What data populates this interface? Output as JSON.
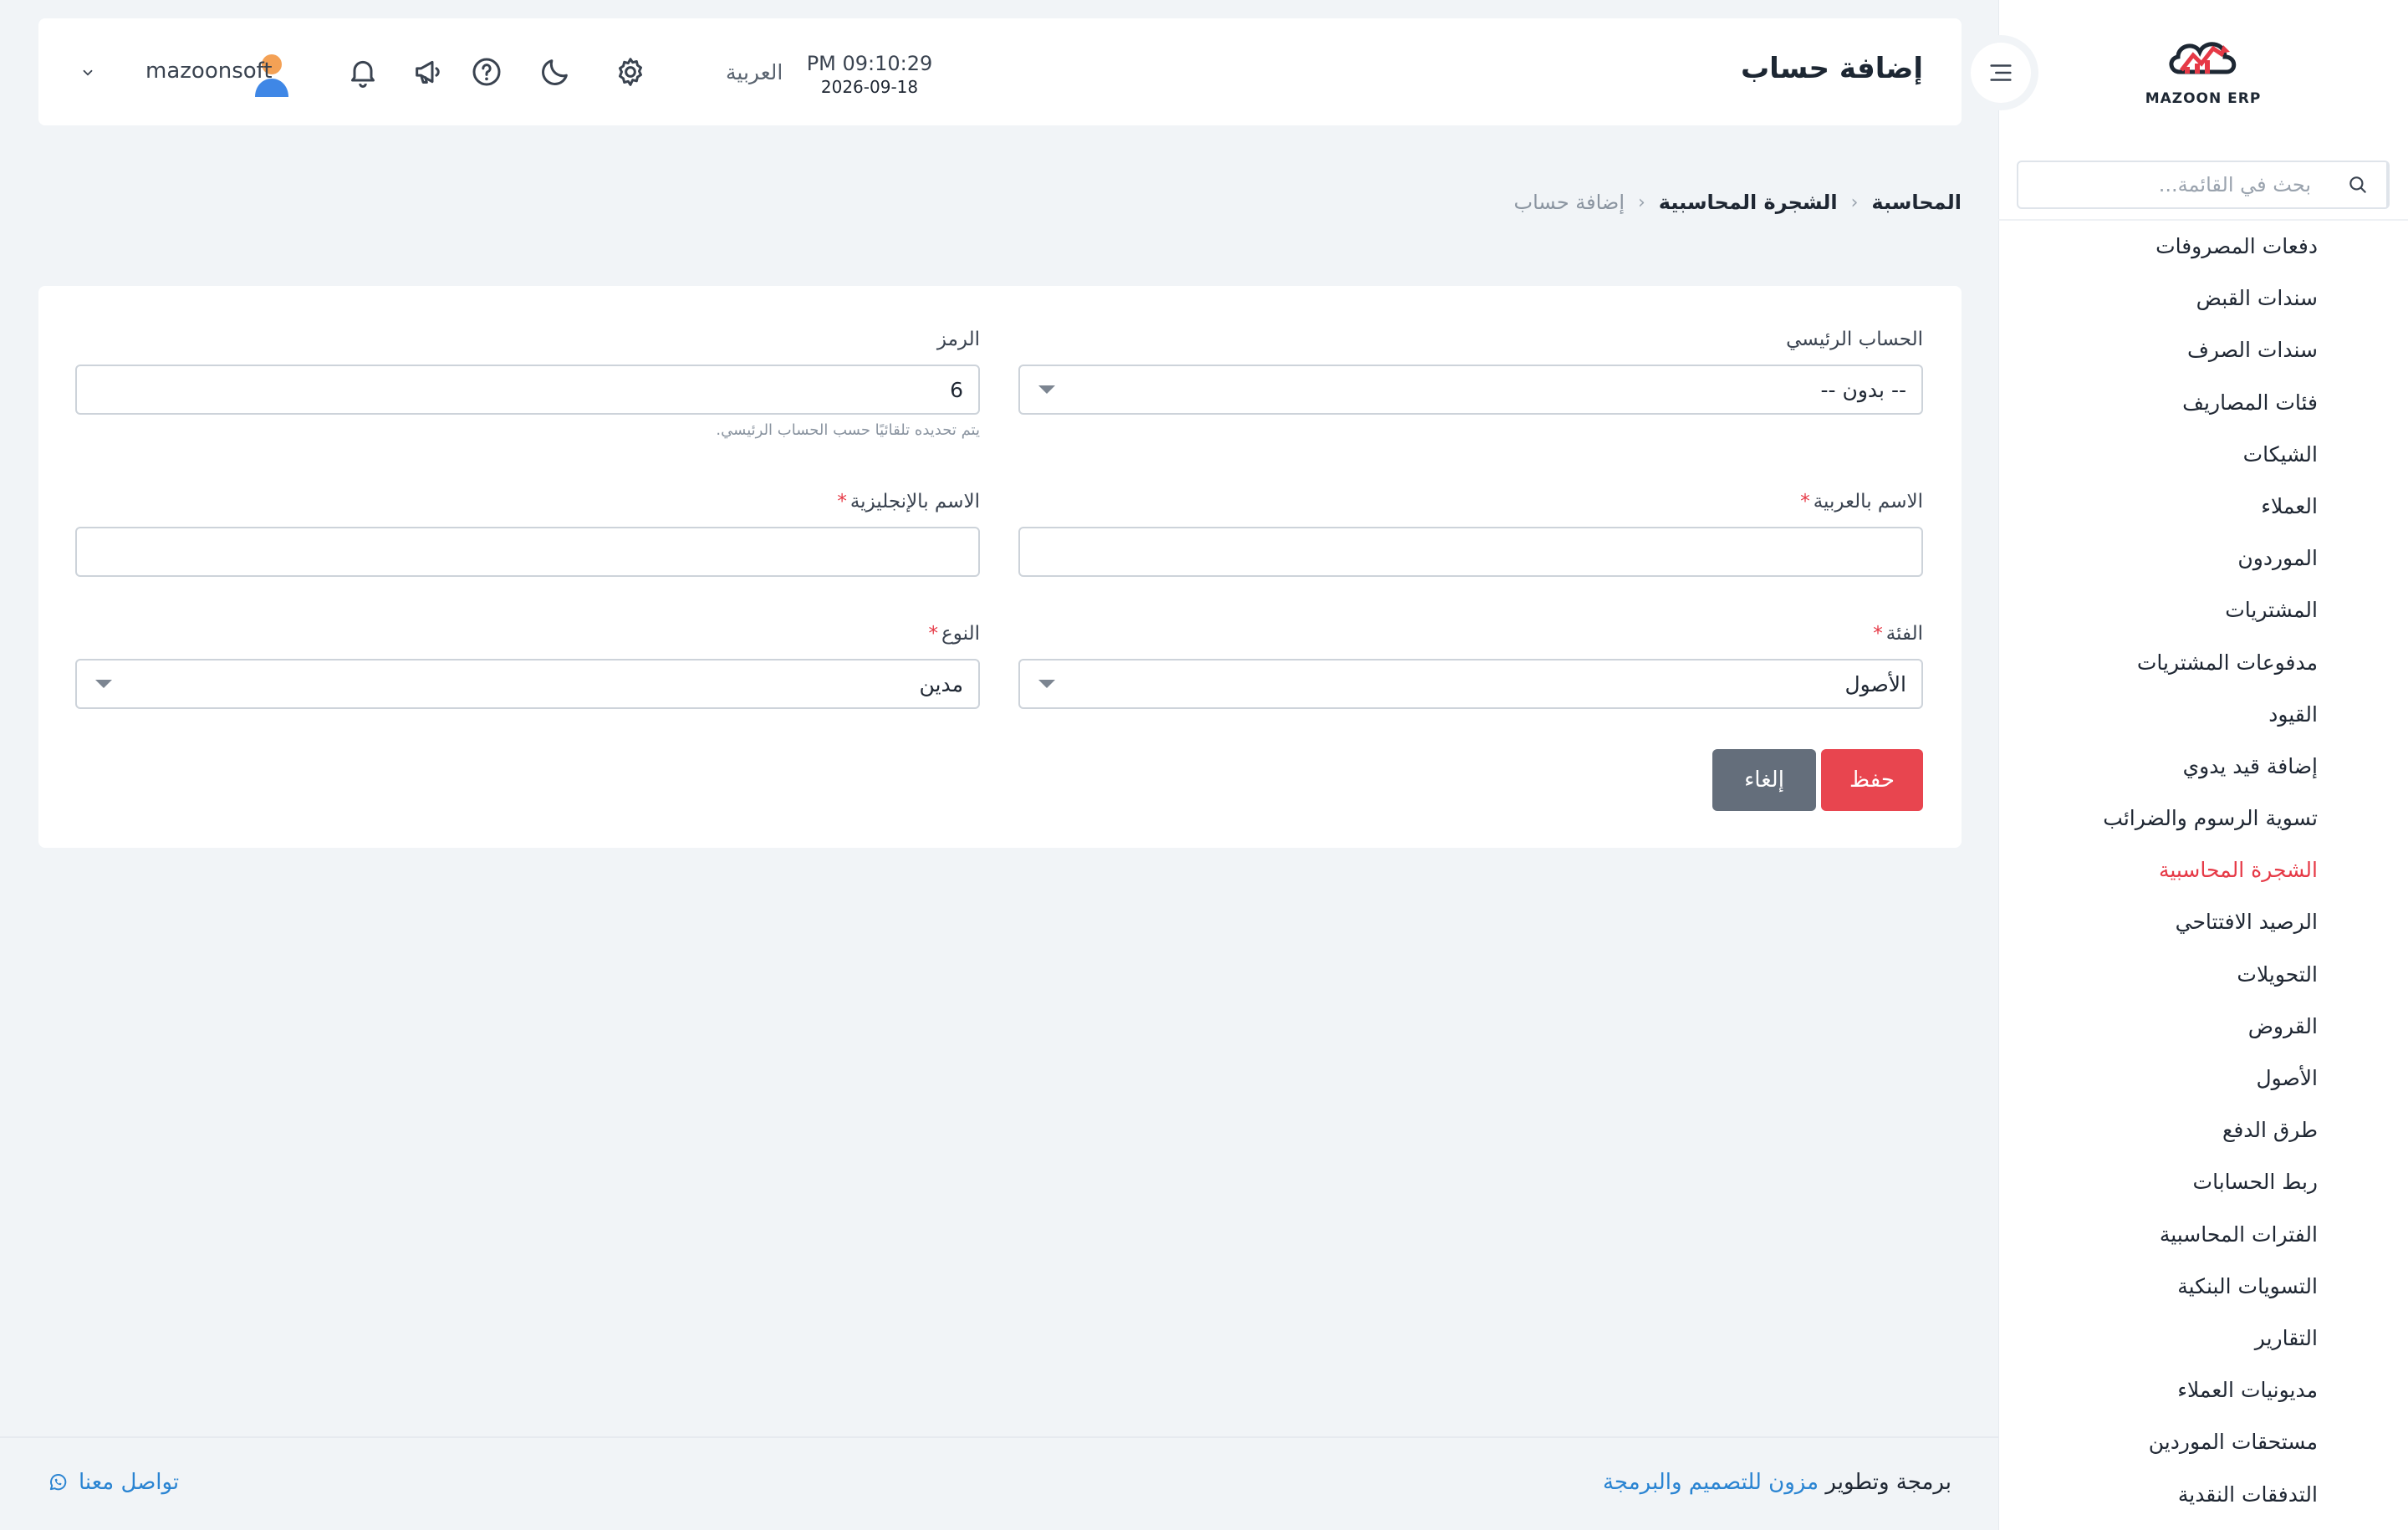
{
  "app": {
    "logo_text": "MAZOON ERP"
  },
  "sidebar": {
    "search_placeholder": "بحث في القائمة...",
    "items": [
      {
        "label": "دفعات المصروفات"
      },
      {
        "label": "سندات القبض"
      },
      {
        "label": "سندات الصرف"
      },
      {
        "label": "فئات المصاريف"
      },
      {
        "label": "الشيكات"
      },
      {
        "label": "العملاء"
      },
      {
        "label": "الموردون"
      },
      {
        "label": "المشتريات"
      },
      {
        "label": "مدفوعات المشتريات"
      },
      {
        "label": "القيود"
      },
      {
        "label": "إضافة قيد يدوي"
      },
      {
        "label": "تسوية الرسوم والضرائب"
      },
      {
        "label": "الشجرة المحاسبية"
      },
      {
        "label": "الرصيد الافتتاحي"
      },
      {
        "label": "التحويلات"
      },
      {
        "label": "القروض"
      },
      {
        "label": "الأصول"
      },
      {
        "label": "طرق الدفع"
      },
      {
        "label": "ربط الحسابات"
      },
      {
        "label": "الفترات المحاسبية"
      },
      {
        "label": "التسويات البنكية"
      },
      {
        "label": "التقارير"
      },
      {
        "label": "مديونيات العملاء"
      },
      {
        "label": "مستحقات الموردين"
      },
      {
        "label": "التدفقات النقدية"
      }
    ],
    "active_index": 12,
    "active_color": "#e63946"
  },
  "header": {
    "title": "إضافة حساب",
    "time": "PM 09:10:29",
    "date": "2026-09-18",
    "language": "العربية",
    "username": "mazoonsoft",
    "icons": [
      "settings-icon",
      "moon-icon",
      "help-icon",
      "megaphone-icon",
      "bell-icon",
      "avatar",
      "chevron-down-icon",
      "menu-toggle-icon"
    ]
  },
  "breadcrumb": {
    "items": [
      "المحاسبة",
      "الشجرة المحاسبية",
      "إضافة حساب"
    ]
  },
  "form": {
    "parent_account": {
      "label": "الحساب الرئيسي",
      "value": "-- بدون --"
    },
    "code": {
      "label": "الرمز",
      "value": "6",
      "hint": "يتم تحديده تلقائيًا حسب الحساب الرئيسي."
    },
    "name_ar": {
      "label": "الاسم بالعربية",
      "required": "*",
      "value": ""
    },
    "name_en": {
      "label": "الاسم بالإنجليزية",
      "required": "*",
      "value": ""
    },
    "category": {
      "label": "الفئة",
      "required": "*",
      "value": "الأصول"
    },
    "type": {
      "label": "النوع",
      "required": "*",
      "value": "مدين"
    },
    "save_label": "حفظ",
    "cancel_label": "إلغاء",
    "save_color": "#e8454f",
    "cancel_color": "#646e7b"
  },
  "footer": {
    "credit_prefix": "برمجة وتطوير",
    "company": "مزون للتصميم والبرمجة",
    "contact": "تواصل معنا"
  }
}
